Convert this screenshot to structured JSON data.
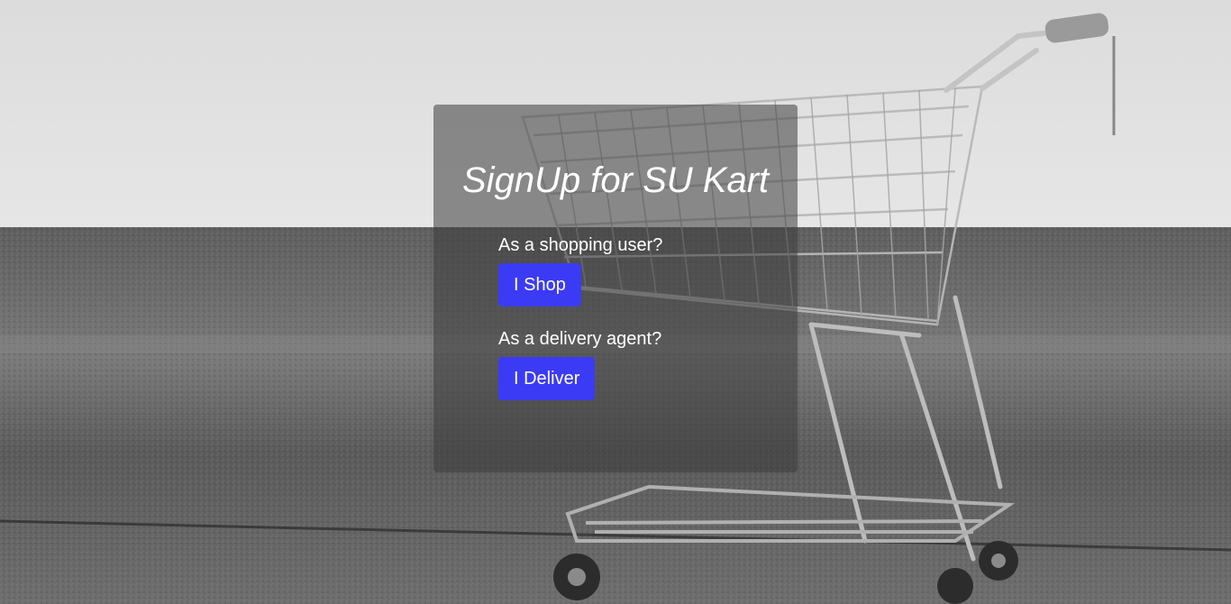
{
  "background": {
    "image": "shopping-cart-photo"
  },
  "signup": {
    "title": "SignUp for SU Kart",
    "shopper_prompt": "As a shopping user?",
    "shop_button_label": "I Shop",
    "delivery_prompt": "As a delivery agent?",
    "deliver_button_label": "I Deliver"
  },
  "colors": {
    "button": "#3b3bf5",
    "card_overlay": "rgba(60,60,60,0.55)",
    "text": "#ffffff"
  }
}
